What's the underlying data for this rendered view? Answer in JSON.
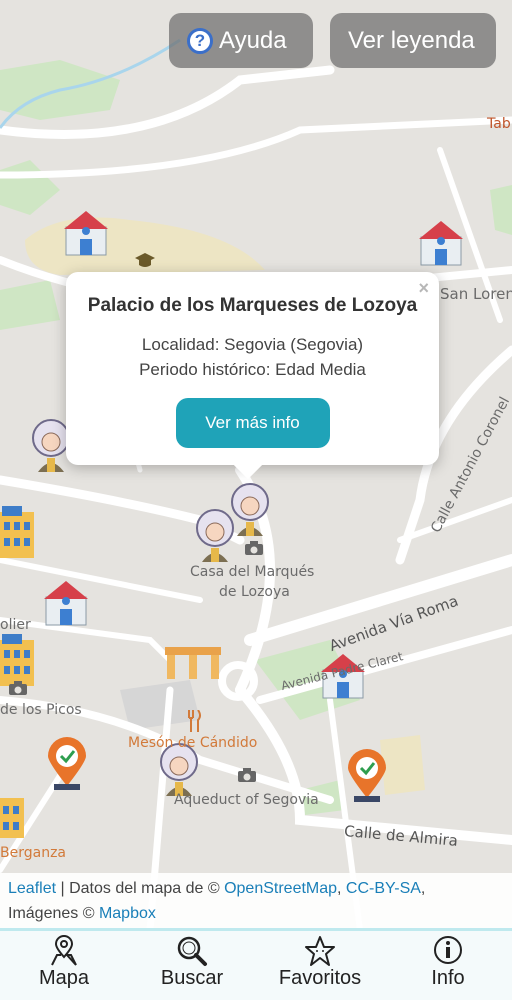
{
  "top_buttons": {
    "help_label": "Ayuda",
    "legend_label": "Ver leyenda"
  },
  "map_labels": {
    "tab": "Tab",
    "san_lorenzo": "San Loren",
    "calle_antonio_coronel": "Calle Antonio Coronel",
    "casa_marques_line1": "Casa del Marqués",
    "casa_marques_line2": "de Lozoya",
    "avenida_via_roma": "Avenida Vía Roma",
    "avenida_padre_claret": "Avenida Padre Claret",
    "olier": "olier",
    "de_los_picos": "de los Picos",
    "meson_candido": "Mesón de Cándido",
    "aqueduct": "Aqueduct of Segovia",
    "calle_almira": "Calle de Almira",
    "berganza": "Berganza"
  },
  "popup": {
    "title": "Palacio de los Marqueses de Lozoya",
    "locality": "Localidad: Segovia (Segovia)",
    "period": "Periodo histórico: Edad Media",
    "button_label": "Ver más info",
    "close_label": "×"
  },
  "attribution": {
    "leaflet": "Leaflet",
    "text1": " | Datos del mapa de © ",
    "osm": "OpenStreetMap",
    "comma": ", ",
    "license": "CC-BY-SA",
    "text2": ",",
    "imagery": "Imágenes © ",
    "mapbox": "Mapbox"
  },
  "nav": {
    "items": [
      {
        "label": "Mapa",
        "icon": "map-pin-icon"
      },
      {
        "label": "Buscar",
        "icon": "search-icon"
      },
      {
        "label": "Favoritos",
        "icon": "star-icon"
      },
      {
        "label": "Info",
        "icon": "info-icon"
      }
    ]
  },
  "colors": {
    "accent": "#1fa3b8",
    "link": "#1a7fb8",
    "marker_orange": "#e8742a"
  }
}
